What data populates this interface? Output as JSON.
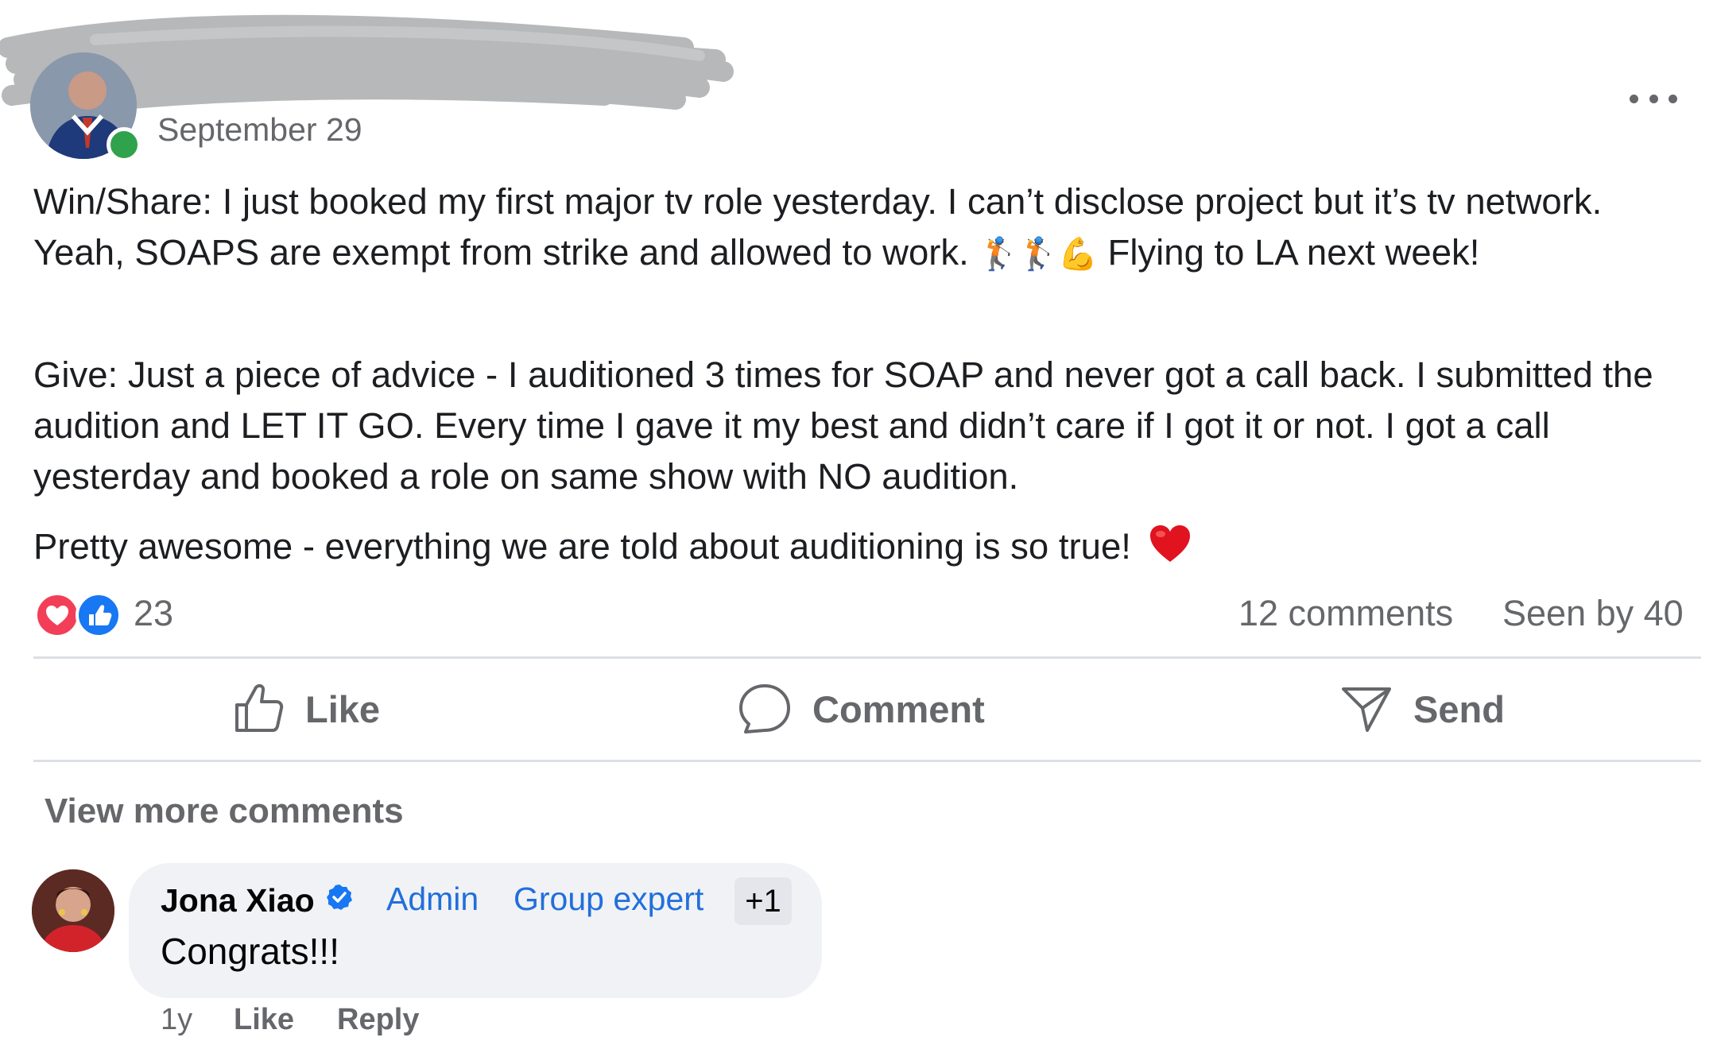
{
  "post": {
    "date": "September 29",
    "paragraph1": {
      "text_before_emoji": "Win/Share:  I just booked my first major tv role yesterday.  I can’t disclose project but it’s tv network.  Yeah,  SOAPS are exempt from strike and allowed to work. ",
      "emoji": "🏌🏌💪",
      "text_after_emoji": " Flying to LA next week!"
    },
    "paragraph2": "Give:  Just a piece of advice -  I auditioned 3 times for SOAP and never got a call back.  I submitted the audition and LET IT GO.  Every time I gave it my best and didn’t care if I got it or not.  I got a call yesterday and booked a role on same show with NO audition.",
    "paragraph3": "Pretty awesome - everything we are told about auditioning is so true!",
    "paragraph3_emoji": "red-heart-icon"
  },
  "reactions": {
    "count": "23",
    "icons": [
      "love-reaction-icon",
      "like-reaction-icon"
    ],
    "comments_count": "12 comments",
    "seen_by": "Seen by 40"
  },
  "actions": {
    "like": "Like",
    "comment": "Comment",
    "send": "Send"
  },
  "comments": {
    "view_more": "View more comments",
    "items": [
      {
        "author": "Jona Xiao",
        "badges": [
          "Admin",
          "Group expert",
          "+1"
        ],
        "text": "Congrats!!!",
        "time": "1y",
        "like": "Like",
        "reply": "Reply"
      }
    ]
  },
  "colors": {
    "accent_blue": "#216fdb",
    "love_red": "#f33e58",
    "online_green": "#31a24c",
    "muted_text": "#65676b"
  }
}
